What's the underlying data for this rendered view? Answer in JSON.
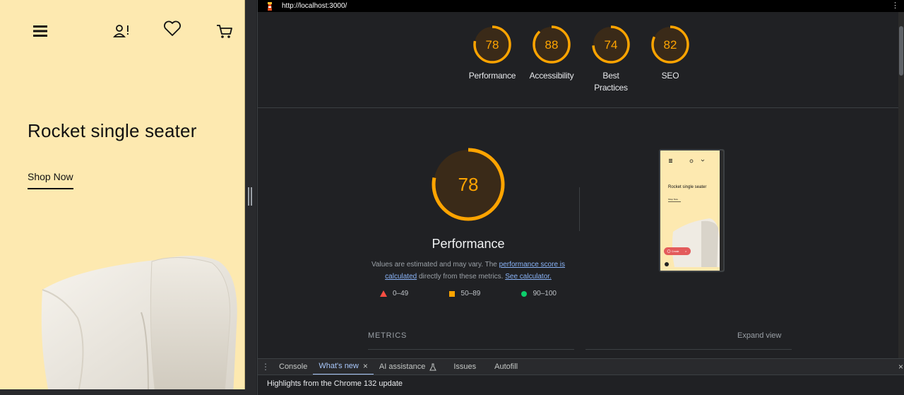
{
  "mobile": {
    "hero_title": "Rocket single seater",
    "cta_label": "Shop Now",
    "icons": [
      "menu-icon",
      "user-alert-icon",
      "heart-icon",
      "cart-icon"
    ],
    "background_color": "#fde9b0"
  },
  "devtools": {
    "url": "http://localhost:3000/",
    "category_scores": [
      {
        "score": "78",
        "label": "Performance"
      },
      {
        "score": "88",
        "label": "Accessibility"
      },
      {
        "score": "74",
        "label": "Best\nPractices"
      },
      {
        "score": "82",
        "label": "SEO"
      }
    ],
    "performance": {
      "score": "78",
      "title": "Performance",
      "desc_part1": "Values are estimated and may vary. The ",
      "link1": "performance score is calculated",
      "desc_part2": " directly from these metrics. ",
      "link2": "See calculator."
    },
    "legend": [
      {
        "range": "0–49",
        "shape": "triangle",
        "color": "#ff4e42"
      },
      {
        "range": "50–89",
        "shape": "square",
        "color": "#ffa400"
      },
      {
        "range": "90–100",
        "shape": "circle",
        "color": "#0cce6b"
      }
    ],
    "thumbnail": {
      "title": "Rocket single seater",
      "cta": "Shop Now",
      "badge": "Create"
    },
    "metrics_label": "METRICS",
    "expand_view": "Expand view",
    "gauge_color": "#ffa400",
    "drawer": {
      "tabs": [
        "Console",
        "What's new",
        "AI assistance",
        "Issues",
        "Autofill"
      ],
      "active_tab": "What's new",
      "content": "Highlights from the Chrome 132 update"
    }
  }
}
